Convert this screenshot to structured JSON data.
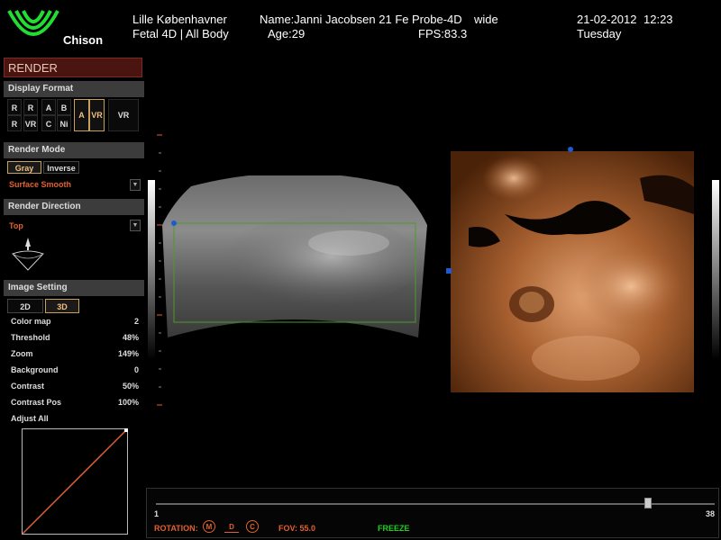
{
  "header": {
    "brand": "Chison",
    "hospital": "Lille Københavner",
    "preset": "Fetal 4D | All Body",
    "patient_name": "Name:Janni Jacobsen 21 Fe",
    "probe": "Probe-4D",
    "probe_mode": "wide",
    "age": "Age:29",
    "fps": "FPS:83.3",
    "date": "21-02-2012",
    "time": "12:23",
    "weekday": "Tuesday"
  },
  "panel": {
    "title": "RENDER",
    "display_format": {
      "label": "Display Format",
      "buttons_row1": [
        "R",
        "R",
        "A",
        "B"
      ],
      "buttons_row2": [
        "R",
        "VR",
        "C",
        "Ni"
      ],
      "active_a": "A",
      "active_vr": "VR",
      "vr_button": "VR"
    },
    "render_mode": {
      "label": "Render Mode",
      "gray": "Gray",
      "inverse": "Inverse",
      "selected": "Surface Smooth"
    },
    "render_direction": {
      "label": "Render Direction",
      "selected": "Top"
    },
    "image_setting": {
      "label": "Image Setting",
      "tab_2d": "2D",
      "tab_3d": "3D",
      "params": [
        {
          "label": "Color map",
          "value": "2"
        },
        {
          "label": "Threshold",
          "value": "48%"
        },
        {
          "label": "Zoom",
          "value": "149%"
        },
        {
          "label": "Background",
          "value": "0"
        },
        {
          "label": "Contrast",
          "value": "50%"
        },
        {
          "label": "Contrast Pos",
          "value": "100%"
        }
      ],
      "adjust_all": "Adjust All"
    }
  },
  "bottom": {
    "slider_min": "1",
    "slider_max": "38",
    "slider_fraction": 0.88,
    "rotation_label": "ROTATION:",
    "rot_m": "M",
    "rot_d": "D",
    "rot_c": "C",
    "fov": "FOV: 55.0",
    "freeze": "FREEZE"
  },
  "colors": {
    "accent_orange": "#e06030",
    "freeze_green": "#20d020",
    "panel_title_bg": "#4a1410",
    "active_border": "#c9a060"
  }
}
